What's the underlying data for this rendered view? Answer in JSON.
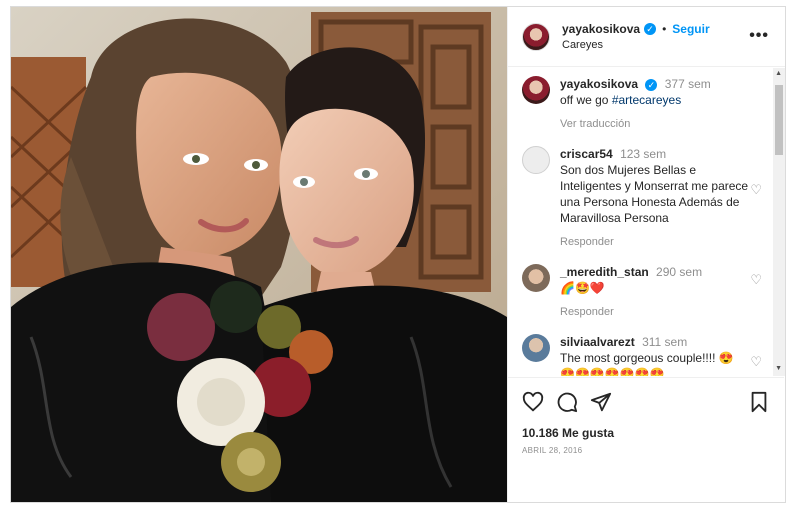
{
  "post": {
    "username": "yayakosikova",
    "follow_label": "Seguir",
    "dot": "•",
    "location": "Careyes",
    "more_label": "•••"
  },
  "caption": {
    "username": "yayakosikova",
    "time": "377 sem",
    "text": "off we go",
    "hashtag": "#artecareyes",
    "translate_label": "Ver traducción"
  },
  "comments": [
    {
      "username": "criscar54",
      "time": "123 sem",
      "text": "Son dos Mujeres Bellas e Inteligentes y Monserrat me parece una Persona Honesta Además de Maravillosa Persona",
      "reply_label": "Responder"
    },
    {
      "username": "_meredith_stan",
      "time": "290 sem",
      "text": "🌈🤩❤️",
      "reply_label": "Responder"
    },
    {
      "username": "silviaalvarezt",
      "time": "311 sem",
      "text": "The most gorgeous couple!!!! 😍 😍😍😍😍😍😍😍"
    }
  ],
  "footer": {
    "likes": "10.186 Me gusta",
    "date": "Abril 28, 2016"
  },
  "icons": {
    "verified": "✓",
    "heart": "♡",
    "scroll_up": "▲",
    "scroll_down": "▼"
  },
  "colors": {
    "link_blue": "#0095f6",
    "muted": "#8e8e8e",
    "text": "#262626"
  }
}
